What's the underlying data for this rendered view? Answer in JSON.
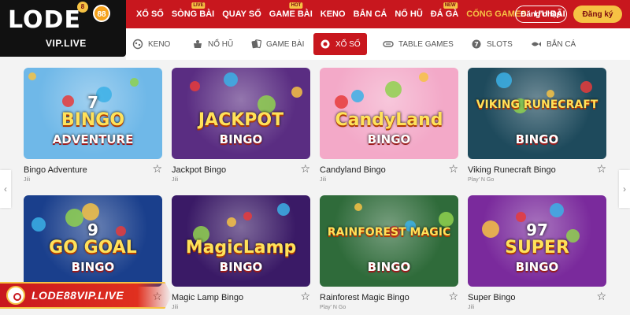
{
  "brand": {
    "logo_text": "LODE",
    "logo_ball": "88",
    "logo_ball_small": "8",
    "logo_sub": "VIP.LIVE"
  },
  "nav": {
    "items": [
      {
        "label": "XỔ SỐ",
        "badge": ""
      },
      {
        "label": "SÒNG BÀI",
        "badge": "LIVE"
      },
      {
        "label": "QUAY SỐ",
        "badge": ""
      },
      {
        "label": "GAME BÀI",
        "badge": "HOT"
      },
      {
        "label": "KENO",
        "badge": ""
      },
      {
        "label": "BẮN CÁ",
        "badge": ""
      },
      {
        "label": "NỔ HŨ",
        "badge": ""
      },
      {
        "label": "ĐÁ GÀ",
        "badge": "NEW"
      },
      {
        "label": "CỔNG GAMES",
        "badge": ""
      },
      {
        "label": "ƯU ĐÃI",
        "badge": ""
      }
    ],
    "active": "CỔNG GAMES",
    "login_label": "Đăng nhập",
    "register_label": "Đăng ký"
  },
  "subtabs": [
    {
      "label": "KENO",
      "icon": "keno-icon"
    },
    {
      "label": "NỔ HŨ",
      "icon": "jackpot-pot-icon"
    },
    {
      "label": "GAME BÀI",
      "icon": "cards-icon"
    },
    {
      "label": "XỔ SỐ",
      "icon": "lottery-icon",
      "active": true
    },
    {
      "label": "TABLE GAMES",
      "icon": "table-icon"
    },
    {
      "label": "SLOTS",
      "icon": "slots-icon"
    },
    {
      "label": "BẮN CÁ",
      "icon": "fish-icon"
    }
  ],
  "games": [
    {
      "name": "Bingo Adventure",
      "provider": "Jili",
      "art_title": "BINGO",
      "art_sub": "ADVENTURE",
      "art_num": "7",
      "bg": "#6fb8e8"
    },
    {
      "name": "Jackpot Bingo",
      "provider": "Jili",
      "art_title": "JACKPOT",
      "art_sub": "BINGO",
      "bg": "#5a2d82"
    },
    {
      "name": "Candyland Bingo",
      "provider": "Jili",
      "art_title": "CandyLand",
      "art_sub": "BINGO",
      "bg": "#f3a9c8"
    },
    {
      "name": "Viking Runecraft Bingo",
      "provider": "Play' N Go",
      "art_title": "VIKING RUNECRAFT",
      "art_sub": "BINGO",
      "bg": "#1e4a5c"
    },
    {
      "name": "Go Goal Bingo",
      "provider": "Jili",
      "art_title": "GO GOAL",
      "art_sub": "BINGO",
      "art_num": "9",
      "bg": "#1a3f8c"
    },
    {
      "name": "Magic Lamp Bingo",
      "provider": "Jili",
      "art_title": "MagicLamp",
      "art_sub": "BINGO",
      "bg": "#3a1a66"
    },
    {
      "name": "Rainforest Magic Bingo",
      "provider": "Play' N Go",
      "art_title": "RAINFOREST MAGIC",
      "art_sub": "BINGO",
      "bg": "#2f6b3a"
    },
    {
      "name": "Super Bingo",
      "provider": "Jili",
      "art_title": "SUPER",
      "art_sub": "BINGO",
      "art_num": "97",
      "bg": "#7a2a9c"
    }
  ],
  "promo": {
    "text": "LODE88VIP.LIVE"
  },
  "colors": {
    "brand_red": "#c8171e",
    "accent_gold": "#f6c244"
  }
}
